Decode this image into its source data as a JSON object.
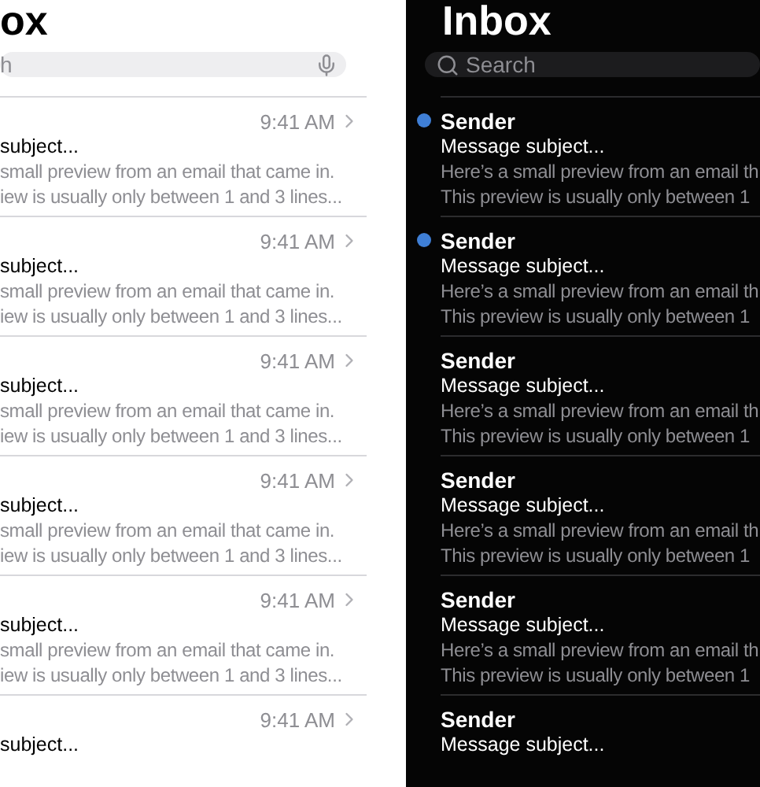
{
  "light_panel": {
    "title": "ox",
    "search": {
      "placeholder": "h"
    },
    "messages": [
      {
        "time": "9:41 AM",
        "subject": "subject...",
        "preview": [
          "small preview from an email that came in.",
          "iew is usually only between 1 and 3 lines..."
        ]
      },
      {
        "time": "9:41 AM",
        "subject": "subject...",
        "preview": [
          "small preview from an email that came in.",
          "iew is usually only between 1 and 3 lines..."
        ]
      },
      {
        "time": "9:41 AM",
        "subject": "subject...",
        "preview": [
          "small preview from an email that came in.",
          "iew is usually only between 1 and 3 lines..."
        ]
      },
      {
        "time": "9:41 AM",
        "subject": "subject...",
        "preview": [
          "small preview from an email that came in.",
          "iew is usually only between 1 and 3 lines..."
        ]
      },
      {
        "time": "9:41 AM",
        "subject": "subject...",
        "preview": [
          "small preview from an email that came in.",
          "iew is usually only between 1 and 3 lines..."
        ]
      },
      {
        "time": "9:41 AM",
        "subject": "subject..."
      }
    ]
  },
  "dark_panel": {
    "title": "Inbox",
    "search": {
      "placeholder": "Search"
    },
    "messages": [
      {
        "unread": true,
        "sender": "Sender",
        "subject": "Message subject...",
        "preview": [
          "Here’s a small preview from an email th",
          "This preview is usually only between 1"
        ]
      },
      {
        "unread": true,
        "sender": "Sender",
        "subject": "Message subject...",
        "preview": [
          "Here’s a small preview from an email th",
          "This preview is usually only between 1"
        ]
      },
      {
        "unread": false,
        "sender": "Sender",
        "subject": "Message subject...",
        "preview": [
          "Here’s a small preview from an email th",
          "This preview is usually only between 1"
        ]
      },
      {
        "unread": false,
        "sender": "Sender",
        "subject": "Message subject...",
        "preview": [
          "Here’s a small preview from an email th",
          "This preview is usually only between 1"
        ]
      },
      {
        "unread": false,
        "sender": "Sender",
        "subject": "Message subject...",
        "preview": [
          "Here’s a small preview from an email th",
          "This preview is usually only between 1"
        ]
      },
      {
        "unread": false,
        "sender": "Sender",
        "subject": "Message subject..."
      }
    ]
  }
}
